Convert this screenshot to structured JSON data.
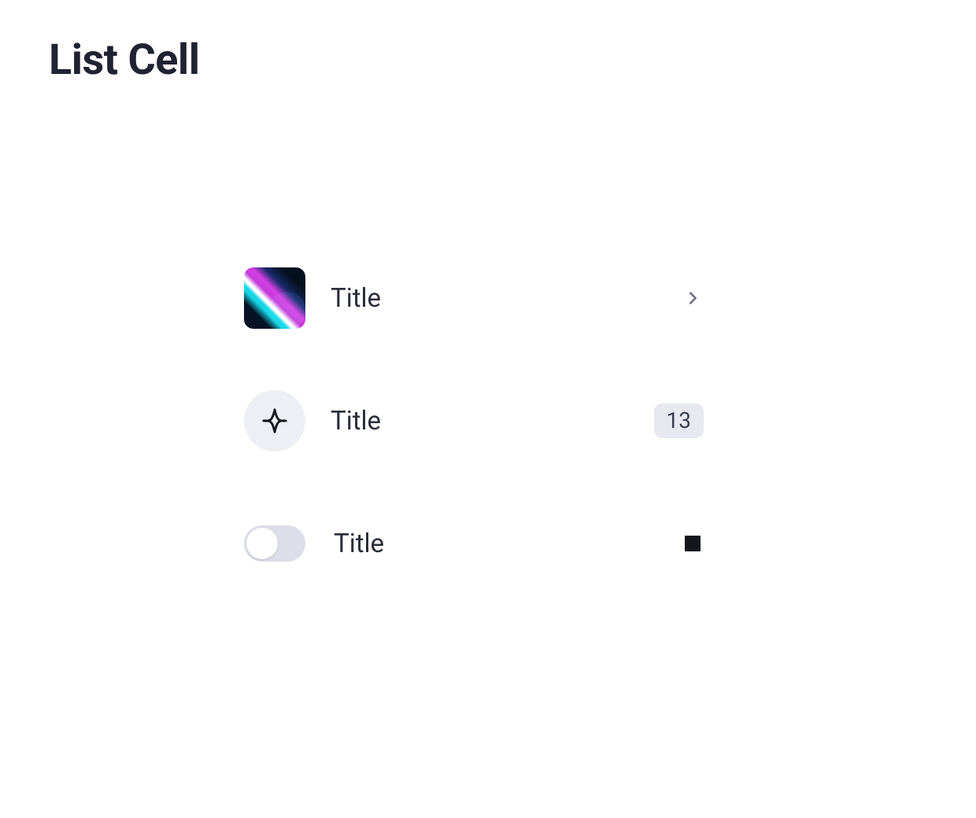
{
  "page": {
    "title": "List Cell"
  },
  "cells": [
    {
      "title": "Title"
    },
    {
      "title": "Title",
      "badge": "13"
    },
    {
      "title": "Title",
      "toggle_on": false
    }
  ]
}
